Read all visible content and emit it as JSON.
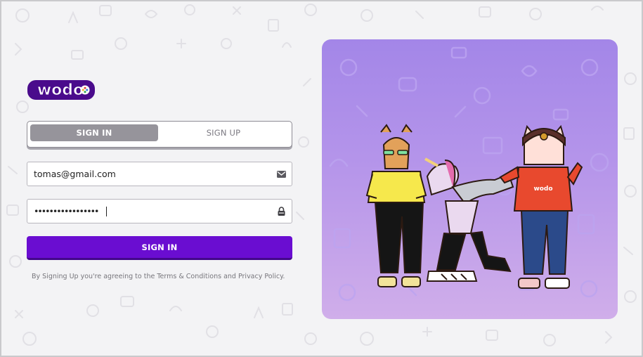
{
  "brand": {
    "logo_text": "wodo",
    "logo_alt": "wodo-logo"
  },
  "auth_tabs": {
    "signin_label": "SIGN IN",
    "signup_label": "SIGN UP",
    "active": "signin"
  },
  "email_field": {
    "value": "tomas@gmail.com",
    "icon": "envelope-icon"
  },
  "password_field": {
    "value": "•••••••••••••••••",
    "icon": "lock-icon"
  },
  "signin_button": {
    "label": "SIGN IN"
  },
  "terms_text": "By Signing Up you're agreeing to the Terms & Conditions and Privacy Policy.",
  "hero": {
    "badge_text": "wodo"
  },
  "colors": {
    "primary": "#6a0dd1",
    "tab_active": "#96949b",
    "illustration_top": "#a386e8",
    "illustration_bottom": "#d0aeea"
  }
}
